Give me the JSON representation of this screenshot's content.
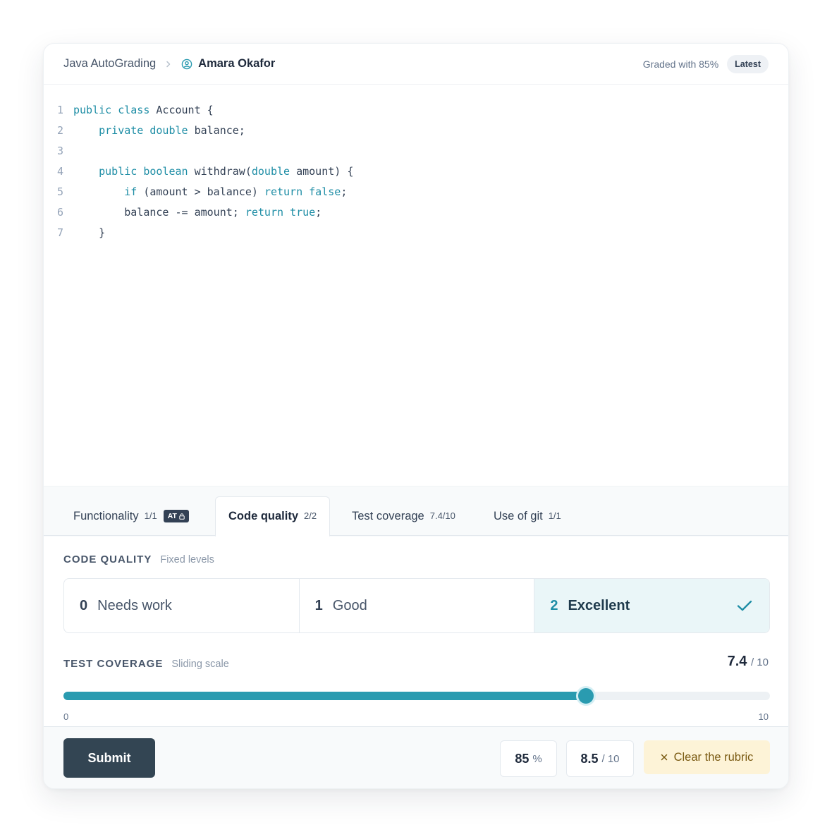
{
  "header": {
    "course": "Java AutoGrading",
    "student": "Amara Okafor",
    "graded_text": "Graded with 85%",
    "badge": "Latest"
  },
  "code": {
    "lines": [
      {
        "num": "1",
        "tokens": [
          [
            "kw",
            "public class "
          ],
          [
            "tx",
            "Account {"
          ]
        ]
      },
      {
        "num": "2",
        "tokens": [
          [
            "tx",
            "    "
          ],
          [
            "kw",
            "private double "
          ],
          [
            "tx",
            "balance;"
          ]
        ]
      },
      {
        "num": "3",
        "tokens": []
      },
      {
        "num": "4",
        "tokens": [
          [
            "tx",
            "    "
          ],
          [
            "kw",
            "public boolean "
          ],
          [
            "tx",
            "withdraw("
          ],
          [
            "kw",
            "double "
          ],
          [
            "tx",
            "amount) {"
          ]
        ]
      },
      {
        "num": "5",
        "tokens": [
          [
            "tx",
            "        "
          ],
          [
            "kw",
            "if "
          ],
          [
            "tx",
            "(amount > balance) "
          ],
          [
            "kw",
            "return false"
          ],
          [
            "tx",
            ";"
          ]
        ]
      },
      {
        "num": "6",
        "tokens": [
          [
            "tx",
            "        balance -= amount; "
          ],
          [
            "kw",
            "return true"
          ],
          [
            "tx",
            ";"
          ]
        ]
      },
      {
        "num": "7",
        "tokens": [
          [
            "tx",
            "    }"
          ]
        ]
      }
    ]
  },
  "tabs": [
    {
      "label": "Functionality",
      "score": "1/1",
      "badge": "AT"
    },
    {
      "label": "Code quality",
      "score": "2/2"
    },
    {
      "label": "Test coverage",
      "score": "7.4/10"
    },
    {
      "label": "Use of git",
      "score": "1/1"
    }
  ],
  "code_quality": {
    "title": "CODE QUALITY",
    "subtitle": "Fixed levels",
    "levels": [
      {
        "num": "0",
        "label": "Needs work"
      },
      {
        "num": "1",
        "label": "Good"
      },
      {
        "num": "2",
        "label": "Excellent"
      }
    ],
    "selected_index": 2
  },
  "test_coverage": {
    "title": "TEST COVERAGE",
    "subtitle": "Sliding scale",
    "value": "7.4",
    "max": "/ 10",
    "min_label": "0",
    "max_label": "10",
    "fraction": 0.74
  },
  "footer": {
    "submit": "Submit",
    "percent_value": "85",
    "percent_unit": "%",
    "points_value": "8.5",
    "points_unit": "/ 10",
    "clear": "Clear the rubric"
  },
  "colors": {
    "accent": "#2a9bb0",
    "dark": "#334553",
    "clear_bg": "#fdf3d7"
  }
}
